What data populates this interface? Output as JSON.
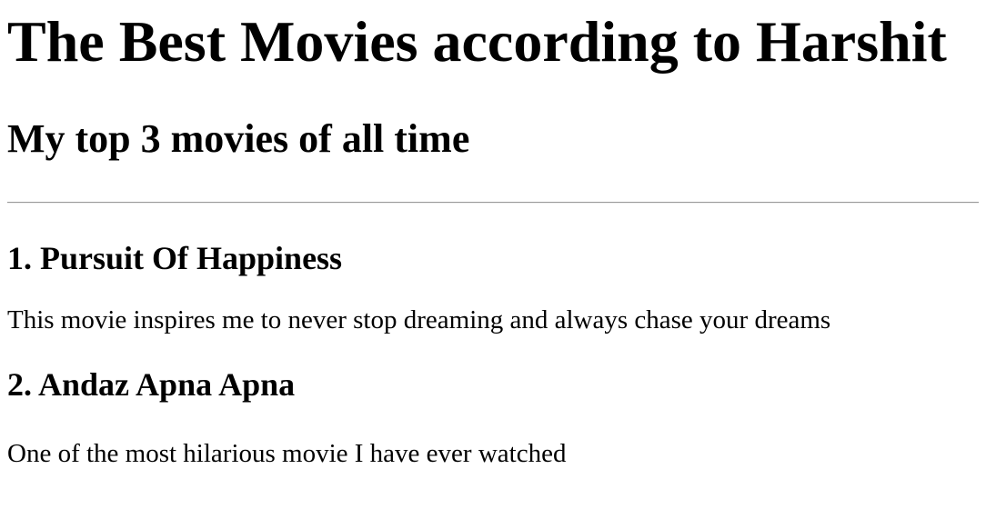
{
  "header": {
    "title": "The Best Movies according to Harshit",
    "subtitle": "My top 3 movies of all time"
  },
  "movies": [
    {
      "heading": "1. Pursuit Of Happiness",
      "description": "This movie inspires me to never stop dreaming and always chase your dreams"
    },
    {
      "heading": "2. Andaz Apna Apna",
      "description": "One of the most hilarious movie I have ever watched"
    }
  ]
}
